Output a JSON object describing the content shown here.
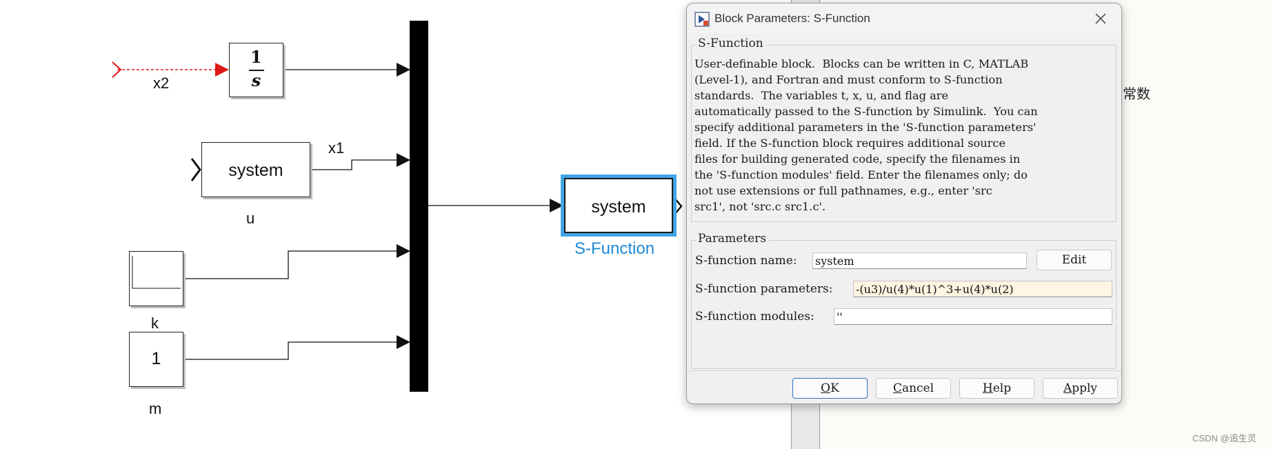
{
  "diagram": {
    "integrator": {
      "numerator": "1",
      "denominator": "s"
    },
    "signal_x2": "x2",
    "system_block": {
      "text": "system",
      "signal": "x1",
      "name": "u"
    },
    "step_block": {
      "name": "k"
    },
    "const_block": {
      "value": "1",
      "name": "m"
    },
    "sfunction_block": {
      "text": "system",
      "name": "S-Function"
    },
    "side_label": "常数",
    "watermark": "CSDN @追生灵"
  },
  "dialog": {
    "title": "Block Parameters: S-Function",
    "group_sfunction": "S-Function",
    "description": "User-definable block.  Blocks can be written in C, MATLAB\n(Level-1), and Fortran and must conform to S-function\nstandards.  The variables t, x, u, and flag are\nautomatically passed to the S-function by Simulink.  You can\nspecify additional parameters in the 'S-function parameters'\nfield. If the S-function block requires additional source\nfiles for building generated code, specify the filenames in\nthe 'S-function modules' field. Enter the filenames only; do\nnot use extensions or full pathnames, e.g., enter 'src\nsrc1', not 'src.c src1.c'.",
    "group_parameters": "Parameters",
    "name_label": "S-function name:",
    "name_value": "system",
    "edit_button": "Edit",
    "params_label": "S-function parameters:",
    "params_value": "-(u3)/u(4)*u(1)^3+u(4)*u(2)",
    "modules_label": "S-function modules:",
    "modules_value": "''",
    "buttons": {
      "ok": {
        "mnemonic": "O",
        "rest": "K"
      },
      "cancel": {
        "mnemonic": "C",
        "rest": "ancel"
      },
      "help": {
        "mnemonic": "H",
        "rest": "elp"
      },
      "apply": {
        "mnemonic": "A",
        "rest": "pply"
      }
    }
  },
  "colors": {
    "selection": "#41a5e6",
    "sfunction_label": "#1e8ad4",
    "x2_line": "#e01818",
    "highlight_field": "#fdf4e1",
    "ok_border": "#2d6fbf"
  }
}
